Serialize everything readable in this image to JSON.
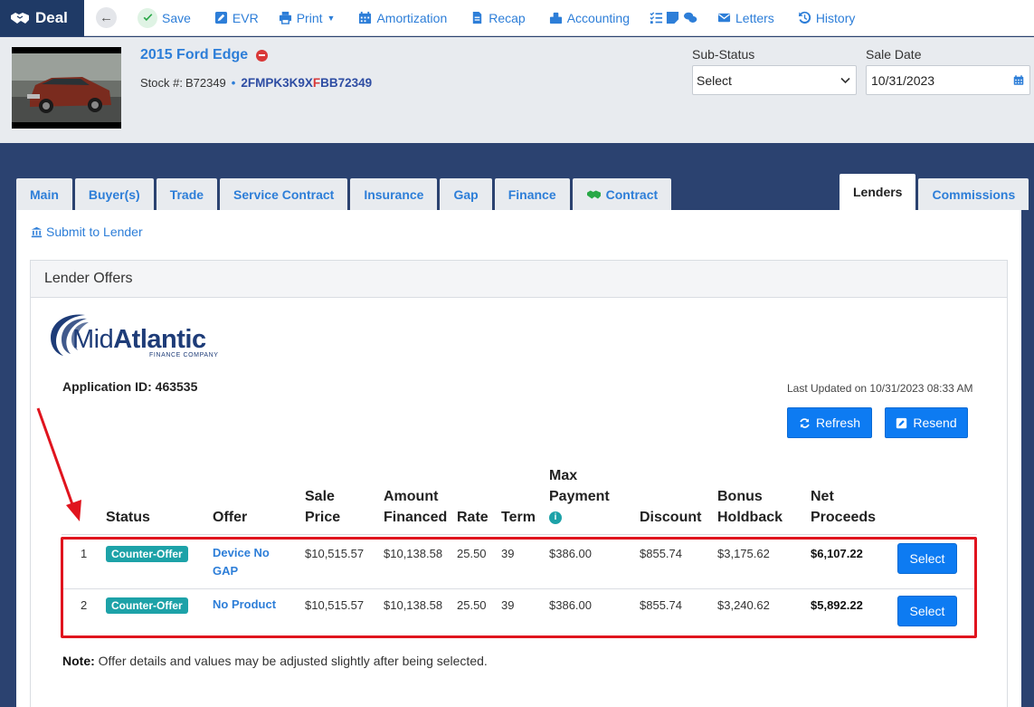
{
  "toolbar": {
    "deal_label": "Deal",
    "items": [
      {
        "id": "save",
        "label": "Save",
        "icon": "check-circle-icon"
      },
      {
        "id": "evr",
        "label": "EVR",
        "icon": "edit-icon"
      },
      {
        "id": "print",
        "label": "Print",
        "icon": "print-icon"
      },
      {
        "id": "amortization",
        "label": "Amortization",
        "icon": "calendar-icon"
      },
      {
        "id": "recap",
        "label": "Recap",
        "icon": "document-icon"
      },
      {
        "id": "accounting",
        "label": "Accounting",
        "icon": "accounting-icon"
      },
      {
        "id": "tasks",
        "label": "",
        "icon": "tasks-notes-chat-icons"
      },
      {
        "id": "letters",
        "label": "Letters",
        "icon": "envelope-icon"
      },
      {
        "id": "history",
        "label": "History",
        "icon": "history-icon"
      }
    ]
  },
  "vehicle": {
    "title": "2015 Ford Edge",
    "stock_label": "Stock #:",
    "stock_number": "B72349",
    "vin_prefix": "2FMPK3K9X",
    "vin_highlight": "F",
    "vin_suffix": "BB72349"
  },
  "fields": {
    "substatus_label": "Sub-Status",
    "substatus_value": "Select",
    "sale_date_label": "Sale Date",
    "sale_date_value": "10/31/2023"
  },
  "tabs": {
    "left": [
      "Main",
      "Buyer(s)",
      "Trade",
      "Service Contract",
      "Insurance",
      "Gap",
      "Finance",
      "Contract"
    ],
    "right": [
      "Lenders",
      "Commissions"
    ],
    "active": "Lenders"
  },
  "lenders": {
    "submit_link": "Submit to Lender",
    "panel_title": "Lender Offers",
    "logo_text_1": "Mid",
    "logo_text_2": "Atlantic",
    "logo_sub": "FINANCE COMPANY",
    "application_id": "Application ID: 463535",
    "last_updated": "Last Updated on 10/31/2023 08:33 AM",
    "refresh_label": "Refresh",
    "resend_label": "Resend",
    "columns": {
      "status": "Status",
      "offer": "Offer",
      "sale_price_1": "Sale",
      "sale_price_2": "Price",
      "amount_financed_1": "Amount",
      "amount_financed_2": "Financed",
      "rate": "Rate",
      "term": "Term",
      "max_payment_1": "Max",
      "max_payment_2": "Payment",
      "discount": "Discount",
      "bonus_holdback_1": "Bonus",
      "bonus_holdback_2": "Holdback",
      "net_proceeds_1": "Net",
      "net_proceeds_2": "Proceeds"
    },
    "rows": [
      {
        "num": "1",
        "status": "Counter-Offer",
        "offer_1": "Device No",
        "offer_2": "GAP",
        "sale_price": "$10,515.57",
        "amount_financed": "$10,138.58",
        "rate": "25.50",
        "term": "39",
        "max_payment": "$386.00",
        "discount": "$855.74",
        "bonus_holdback": "$3,175.62",
        "net_proceeds": "$6,107.22",
        "select_label": "Select"
      },
      {
        "num": "2",
        "status": "Counter-Offer",
        "offer_1": "No Product",
        "offer_2": "",
        "sale_price": "$10,515.57",
        "amount_financed": "$10,138.58",
        "rate": "25.50",
        "term": "39",
        "max_payment": "$386.00",
        "discount": "$855.74",
        "bonus_holdback": "$3,240.62",
        "net_proceeds": "$5,892.22",
        "select_label": "Select"
      }
    ],
    "note_label": "Note:",
    "note_text": " Offer details and values may be adjusted slightly after being selected."
  },
  "colors": {
    "brand_navy": "#1f3a66",
    "link_blue": "#2d7ed8",
    "button_blue": "#0d7bf2",
    "badge_teal": "#1da2a8",
    "annotation_red": "#e0141e"
  }
}
